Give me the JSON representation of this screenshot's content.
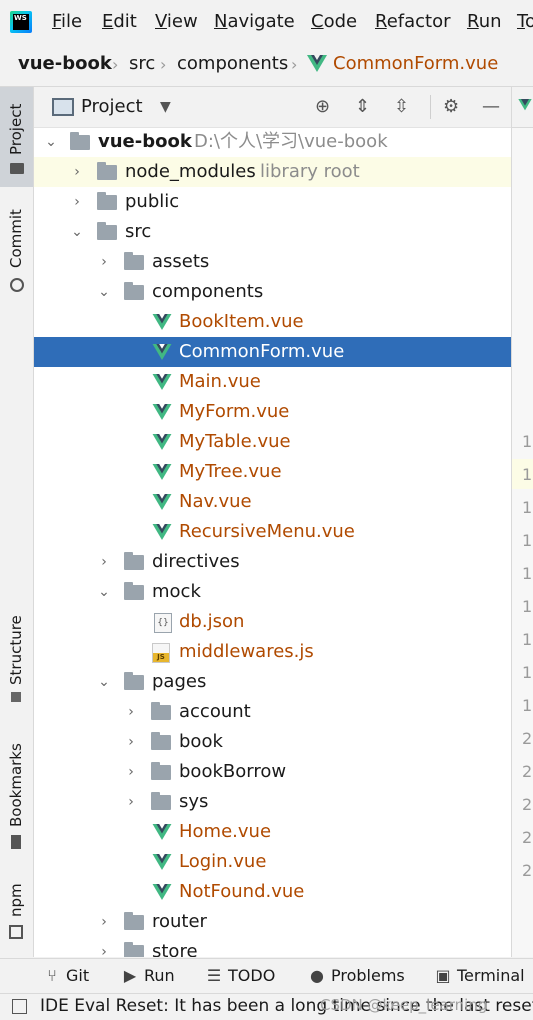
{
  "menubar": {
    "logo": "WS",
    "items": [
      "File",
      "Edit",
      "View",
      "Navigate",
      "Code",
      "Refactor",
      "Run",
      "To"
    ]
  },
  "breadcrumb": {
    "project": "vue-book",
    "folder1": "src",
    "folder2": "components",
    "file": "CommonForm.vue"
  },
  "leftstrip": {
    "project": "Project",
    "commit": "Commit",
    "structure": "Structure",
    "bookmarks": "Bookmarks",
    "npm": "npm"
  },
  "panel": {
    "title": "Project",
    "root_name": "vue-book",
    "root_path": "D:\\个人\\学习\\vue-book",
    "node_modules": "node_modules",
    "library_root": "library root",
    "public": "public",
    "src": "src",
    "assets": "assets",
    "components": "components",
    "files_components": [
      "BookItem.vue",
      "CommonForm.vue",
      "Main.vue",
      "MyForm.vue",
      "MyTable.vue",
      "MyTree.vue",
      "Nav.vue",
      "RecursiveMenu.vue"
    ],
    "directives": "directives",
    "mock": "mock",
    "db_json": "db.json",
    "middlewares_js": "middlewares.js",
    "pages": "pages",
    "account": "account",
    "book": "book",
    "bookBorrow": "bookBorrow",
    "sys": "sys",
    "files_pages": [
      "Home.vue",
      "Login.vue",
      "NotFound.vue"
    ],
    "router": "router",
    "store": "store"
  },
  "editor": {
    "gutter": [
      "1",
      "1",
      "1",
      "1",
      "1",
      "1",
      "1",
      "1",
      "1",
      "2",
      "2",
      "2",
      "2",
      "2"
    ]
  },
  "bottombar": {
    "git": "Git",
    "run": "Run",
    "todo": "TODO",
    "problems": "Problems",
    "terminal": "Terminal"
  },
  "statusbar": {
    "message": "IDE Eval Reset: It has been a long time since the last reset!",
    "watermark": "CSDN @keep_learning"
  }
}
